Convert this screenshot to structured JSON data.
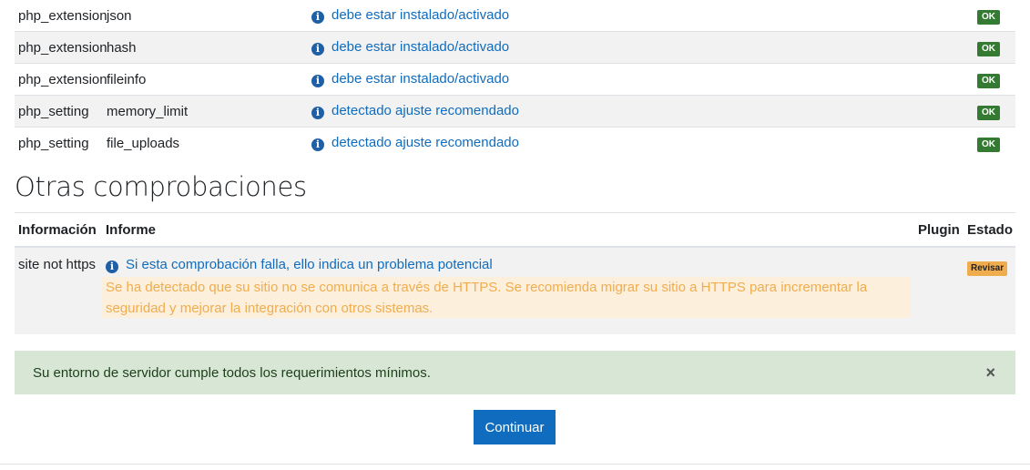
{
  "checks": [
    {
      "type": "php_extension",
      "name": "json",
      "report": "debe estar instalado/activado",
      "status": "OK"
    },
    {
      "type": "php_extension",
      "name": "hash",
      "report": "debe estar instalado/activado",
      "status": "OK"
    },
    {
      "type": "php_extension",
      "name": "fileinfo",
      "report": "debe estar instalado/activado",
      "status": "OK"
    },
    {
      "type": "php_setting",
      "name": "memory_limit",
      "report": "detectado ajuste recomendado",
      "status": "OK"
    },
    {
      "type": "php_setting",
      "name": "file_uploads",
      "report": "detectado ajuste recomendado",
      "status": "OK"
    }
  ],
  "other": {
    "title": "Otras comprobaciones",
    "headers": {
      "info": "Información",
      "report": "Informe",
      "plugin": "Plugin",
      "status": "Estado"
    },
    "row": {
      "info": "site not https",
      "report": "Si esta comprobación falla, ello indica un problema potencial",
      "warning": "Se ha detectado que su sitio no se comunica a través de HTTPS. Se recomienda migrar su sitio a HTTPS para incrementar la seguridad y mejorar la integración con otros sistemas.",
      "status": "Revisar"
    }
  },
  "alert": {
    "message": "Su entorno de servidor cumple todos los requerimientos mínimos.",
    "close": "×"
  },
  "continue_label": "Continuar",
  "icons": {
    "info": "info-circle-icon",
    "close": "close-icon"
  },
  "colors": {
    "ok": "#357a32",
    "warn": "#f0ad4e",
    "link": "#0f6cbf",
    "success_bg": "#d7e6d5",
    "primary": "#0f6cbf"
  }
}
